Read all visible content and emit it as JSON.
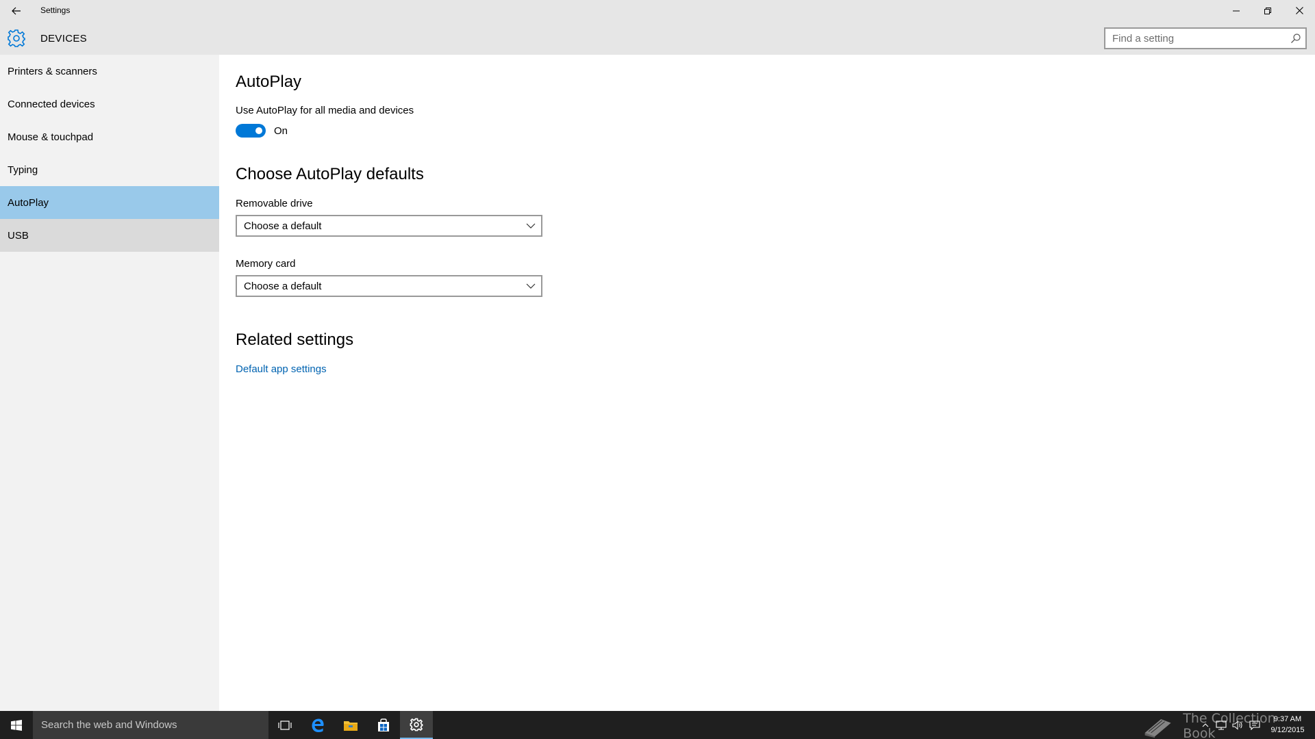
{
  "window": {
    "title": "Settings",
    "section": "DEVICES"
  },
  "search": {
    "placeholder": "Find a setting"
  },
  "sidebar": {
    "items": [
      {
        "label": "Printers & scanners"
      },
      {
        "label": "Connected devices"
      },
      {
        "label": "Mouse & touchpad"
      },
      {
        "label": "Typing"
      },
      {
        "label": "AutoPlay"
      },
      {
        "label": "USB"
      }
    ],
    "selected": "AutoPlay"
  },
  "main": {
    "heading": "AutoPlay",
    "autoplay_toggle": {
      "label": "Use AutoPlay for all media and devices",
      "state": "On",
      "on": true
    },
    "defaults_heading": "Choose AutoPlay defaults",
    "removable_drive": {
      "label": "Removable drive",
      "value": "Choose a default"
    },
    "memory_card": {
      "label": "Memory card",
      "value": "Choose a default"
    },
    "related_heading": "Related settings",
    "related_link": "Default app settings"
  },
  "taskbar": {
    "search_text": "Search the web and Windows",
    "watermark": "The Collection Book",
    "time": "9:37 AM",
    "date": "9/12/2015"
  },
  "colors": {
    "accent": "#0078d7",
    "selected_nav": "#99c9ea",
    "link": "#0063b1",
    "taskbar": "#1f1f1f"
  }
}
